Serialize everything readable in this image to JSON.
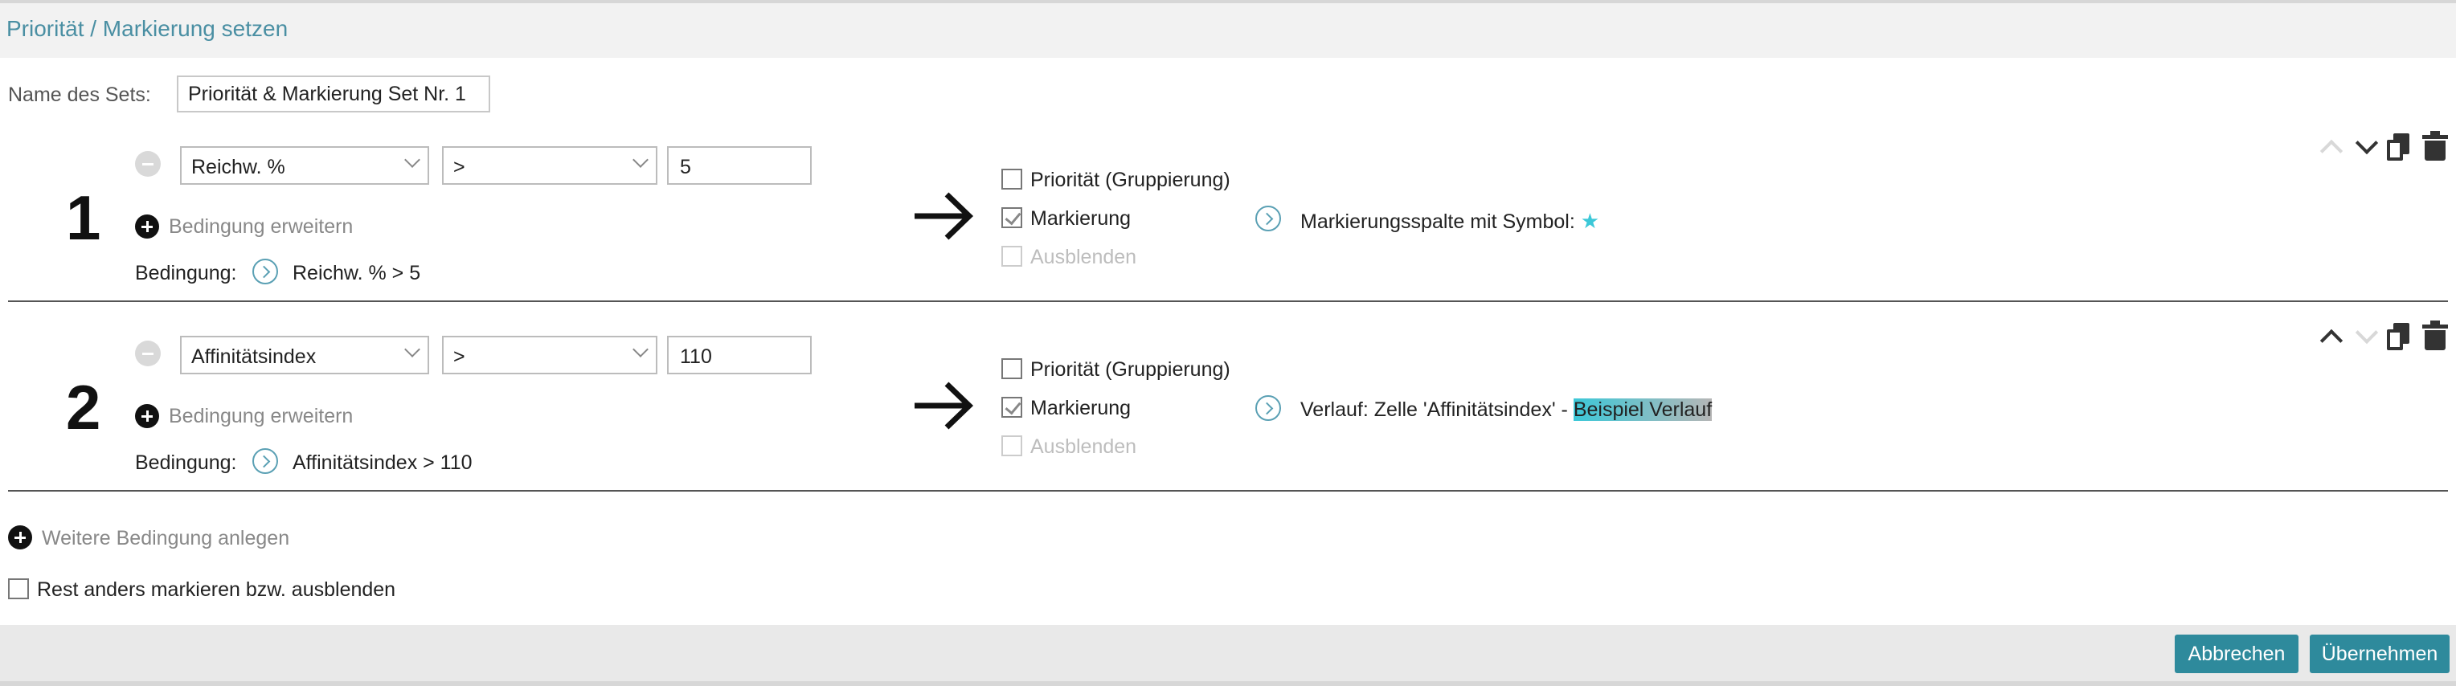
{
  "dialog": {
    "title": "Priorität / Markierung setzen"
  },
  "set_name": {
    "label": "Name des Sets:",
    "value": "Priorität & Markierung Set Nr. 1"
  },
  "rules": [
    {
      "number": "1",
      "field": "Reichw. %",
      "operator": ">",
      "value": "5",
      "extend_label": "Bedingung erweitern",
      "condition_label": "Bedingung:",
      "condition_text": "Reichw. % > 5",
      "priority_label": "Priorität (Gruppierung)",
      "priority_checked": false,
      "marking_label": "Markierung",
      "marking_checked": true,
      "hide_label": "Ausblenden",
      "detail_text": "Markierungsspalte mit Symbol:",
      "detail_icon": "star-icon",
      "move_up_enabled": false,
      "move_down_enabled": true
    },
    {
      "number": "2",
      "field": "Affinitätsindex",
      "operator": ">",
      "value": "110",
      "extend_label": "Bedingung erweitern",
      "condition_label": "Bedingung:",
      "condition_text": "Affinitätsindex > 110",
      "priority_label": "Priorität (Gruppierung)",
      "priority_checked": false,
      "marking_label": "Markierung",
      "marking_checked": true,
      "hide_label": "Ausblenden",
      "detail_text": "Verlauf: Zelle 'Affinitätsindex' - ",
      "detail_sample": "Beispiel Verlauf",
      "move_up_enabled": true,
      "move_down_enabled": false
    }
  ],
  "add_condition_label": "Weitere Bedingung anlegen",
  "rest_option": {
    "label": "Rest anders markieren bzw. ausblenden",
    "checked": false
  },
  "buttons": {
    "cancel": "Abbrechen",
    "apply": "Übernehmen"
  },
  "colors": {
    "accent": "#2e8a9c",
    "title": "#4a8fa3",
    "star": "#3cc8d8"
  }
}
